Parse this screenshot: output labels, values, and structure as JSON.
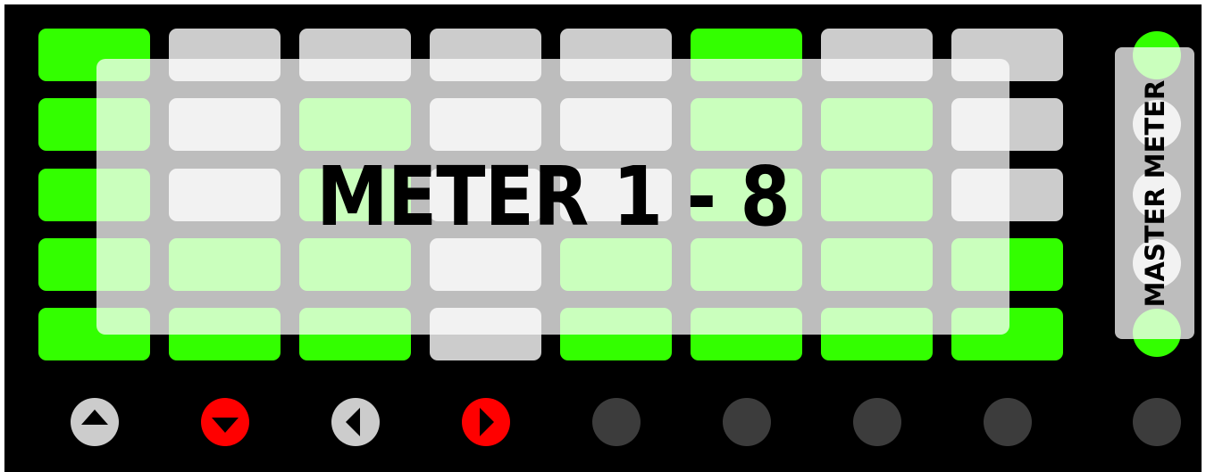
{
  "overlay": {
    "title": "METER 1 - 8"
  },
  "master": {
    "title": "MASTER METER",
    "pads": [
      "on",
      "off",
      "off",
      "off",
      "on"
    ]
  },
  "colors": {
    "pad_on": "#33ff00",
    "pad_off": "#cccccc",
    "button_grey": "#cccccc",
    "button_red": "#ff0000",
    "button_dark": "#3c3c3c",
    "background": "#000000"
  },
  "meters": [
    {
      "name": "meter-1",
      "rows": [
        "on",
        "on",
        "on",
        "on",
        "on"
      ]
    },
    {
      "name": "meter-2",
      "rows": [
        "off",
        "off",
        "off",
        "on",
        "on"
      ]
    },
    {
      "name": "meter-3",
      "rows": [
        "off",
        "on",
        "on",
        "on",
        "on"
      ]
    },
    {
      "name": "meter-4",
      "rows": [
        "off",
        "off",
        "off",
        "off",
        "off"
      ]
    },
    {
      "name": "meter-5",
      "rows": [
        "off",
        "off",
        "off",
        "on",
        "on"
      ]
    },
    {
      "name": "meter-6",
      "rows": [
        "on",
        "on",
        "on",
        "on",
        "on"
      ]
    },
    {
      "name": "meter-7",
      "rows": [
        "off",
        "on",
        "on",
        "on",
        "on"
      ]
    },
    {
      "name": "meter-8",
      "rows": [
        "off",
        "off",
        "off",
        "on",
        "on"
      ]
    }
  ],
  "buttons": [
    {
      "name": "up-arrow-button",
      "icon": "triangle-up-icon",
      "color": "grey"
    },
    {
      "name": "down-arrow-button",
      "icon": "triangle-down-icon",
      "color": "red"
    },
    {
      "name": "left-arrow-button",
      "icon": "triangle-left-icon",
      "color": "grey"
    },
    {
      "name": "right-arrow-button",
      "icon": "triangle-right-icon",
      "color": "red"
    },
    {
      "name": "scene-button-5",
      "icon": "",
      "color": "dark"
    },
    {
      "name": "scene-button-6",
      "icon": "",
      "color": "dark"
    },
    {
      "name": "scene-button-7",
      "icon": "",
      "color": "dark"
    },
    {
      "name": "scene-button-8",
      "icon": "",
      "color": "dark"
    }
  ],
  "stop_button": {
    "name": "stop-button",
    "color": "dark"
  }
}
